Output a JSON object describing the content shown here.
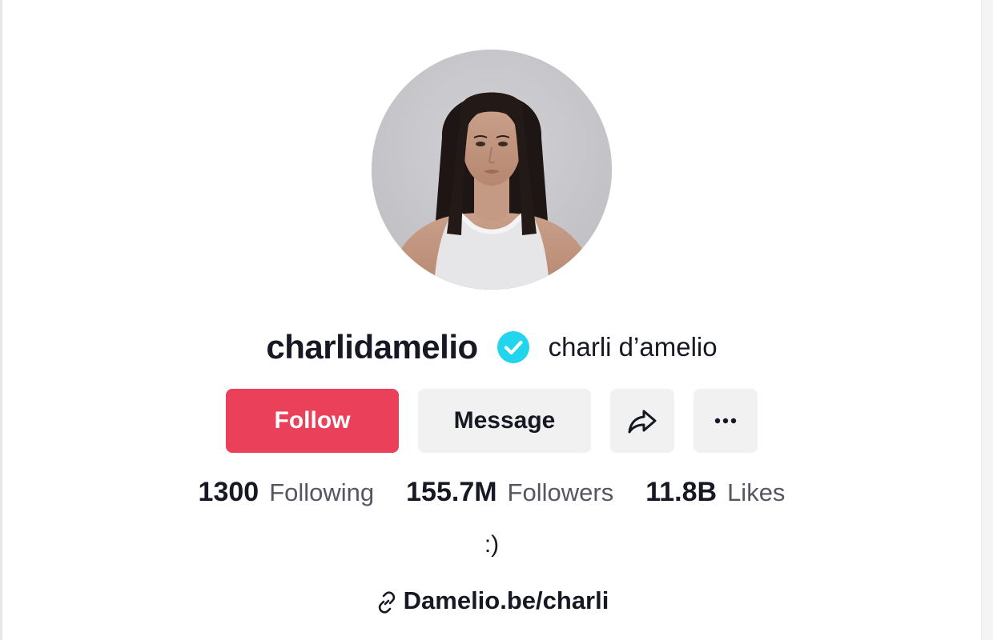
{
  "profile": {
    "username": "charlidamelio",
    "display_name": "charli d’amelio",
    "verified": true,
    "bio": ":)",
    "link": "Damelio.be/charli"
  },
  "actions": {
    "follow_label": "Follow",
    "message_label": "Message",
    "share_icon": "share-arrow-icon",
    "more_icon": "ellipsis-icon"
  },
  "stats": [
    {
      "value": "1300",
      "label": "Following"
    },
    {
      "value": "155.7M",
      "label": "Followers"
    },
    {
      "value": "11.8B",
      "label": "Likes"
    }
  ],
  "colors": {
    "follow": "#ea405a",
    "verified": "#20d5ec",
    "button_bg": "#f1f1f2"
  }
}
